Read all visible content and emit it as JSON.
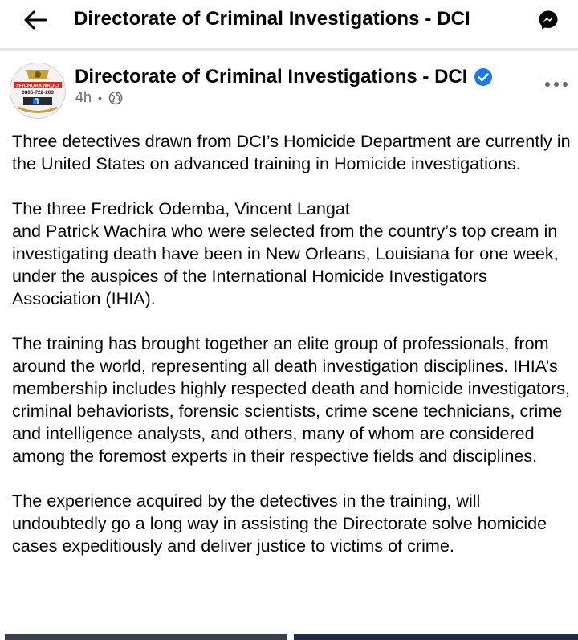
{
  "header": {
    "title": "Directorate of Criminal Investigations - DCI",
    "back_icon": "arrow-left-icon",
    "messenger_icon": "messenger-icon"
  },
  "post": {
    "author": "Directorate of Criminal Investigations - DCI",
    "avatar": {
      "banner_text": "#FICHUAKWADCI",
      "phone": "0806-722-203"
    },
    "time": "4h",
    "audience_icon": "globe-icon",
    "verified_icon": "verified-badge-icon",
    "more_icon": "more-horizontal-icon",
    "paragraphs": [
      "Three detectives drawn from DCI’s Homicide Department are currently in the United States on advanced training in Homicide investigations.",
      "The three Fredrick Odemba, Vincent Langat\nand Patrick Wachira who were selected from the country’s top cream in investigating death have been in New Orleans, Louisiana for one week, under the auspices of the International Homicide Investigators Association (IHIA).",
      "The training has brought together an elite group of professionals, from around the world, representing all death investigation disciplines. IHIA’s membership includes highly respected death and homicide investigators, criminal behaviorists, forensic scientists, crime scene technicians, crime and intelligence analysts, and others, many of whom are considered among the foremost experts in their respective fields and disciplines.",
      "The experience acquired by the detectives in the training, will undoubtedly go a long way in assisting the Directorate solve homicide cases expeditiously and deliver justice to victims of crime."
    ]
  },
  "colors": {
    "verified_blue": "#1877f2",
    "meta_gray": "#65676b",
    "divider_gray": "#e4e6eb",
    "avatar_banner_red": "#d9261c"
  }
}
